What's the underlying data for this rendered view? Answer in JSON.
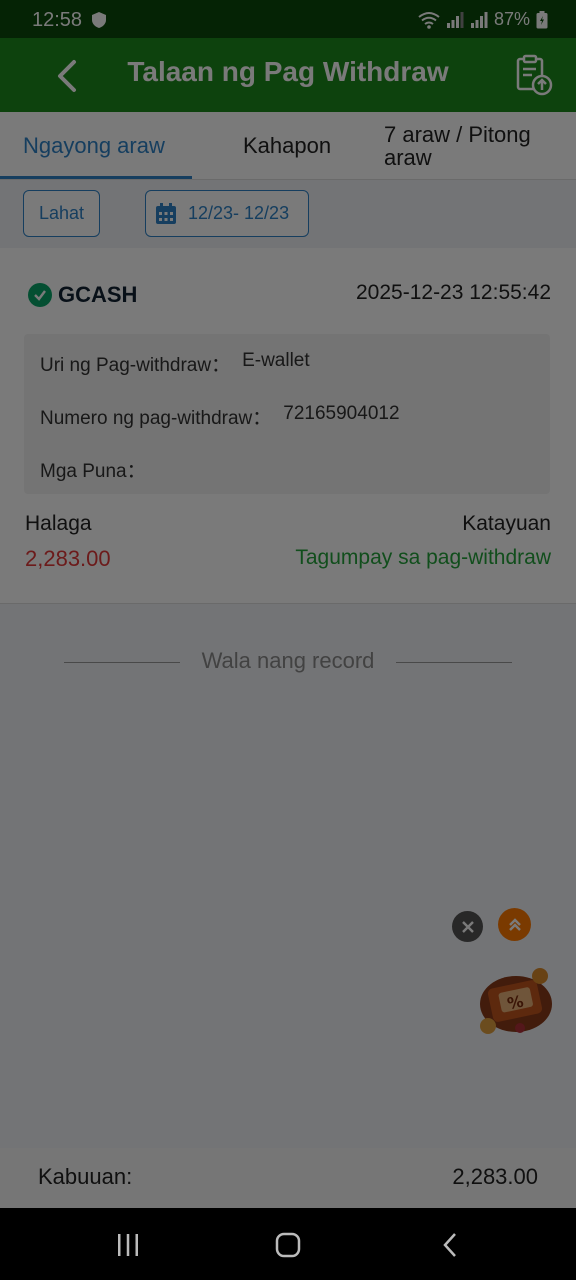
{
  "status_bar": {
    "time": "12:58",
    "battery": "87%"
  },
  "header": {
    "title": "Talaan ng Pag Withdraw",
    "back_icon": "back-arrow-icon",
    "record_icon": "clipboard-upload-icon"
  },
  "tabs": [
    {
      "label": "Ngayong araw",
      "active": true
    },
    {
      "label": "Kahapon",
      "active": false
    },
    {
      "label": "7 araw / Pitong araw",
      "active": false
    }
  ],
  "filters": {
    "all_label": "Lahat",
    "date_range": "12/23- 12/23"
  },
  "record": {
    "method": "GCASH",
    "datetime": "2025-12-23 12:55:42",
    "type_label": "Uri ng Pag-withdraw：",
    "type_value": "E-wallet",
    "number_label": "Numero ng pag-withdraw：",
    "number_value": "72165904012",
    "remarks_label": "Mga Puna：",
    "remarks_value": "",
    "amount_label": "Halaga",
    "amount_value": "2,283.00",
    "status_label": "Katayuan",
    "status_value": "Tagumpay sa pag-withdraw"
  },
  "empty_text": "Wala nang record",
  "total": {
    "label": "Kabuuan:",
    "value": "2,283.00"
  },
  "colors": {
    "header": "#1c8a1c",
    "accent": "#2e83c7",
    "amount": "#e23a3a",
    "success": "#24a33c"
  }
}
